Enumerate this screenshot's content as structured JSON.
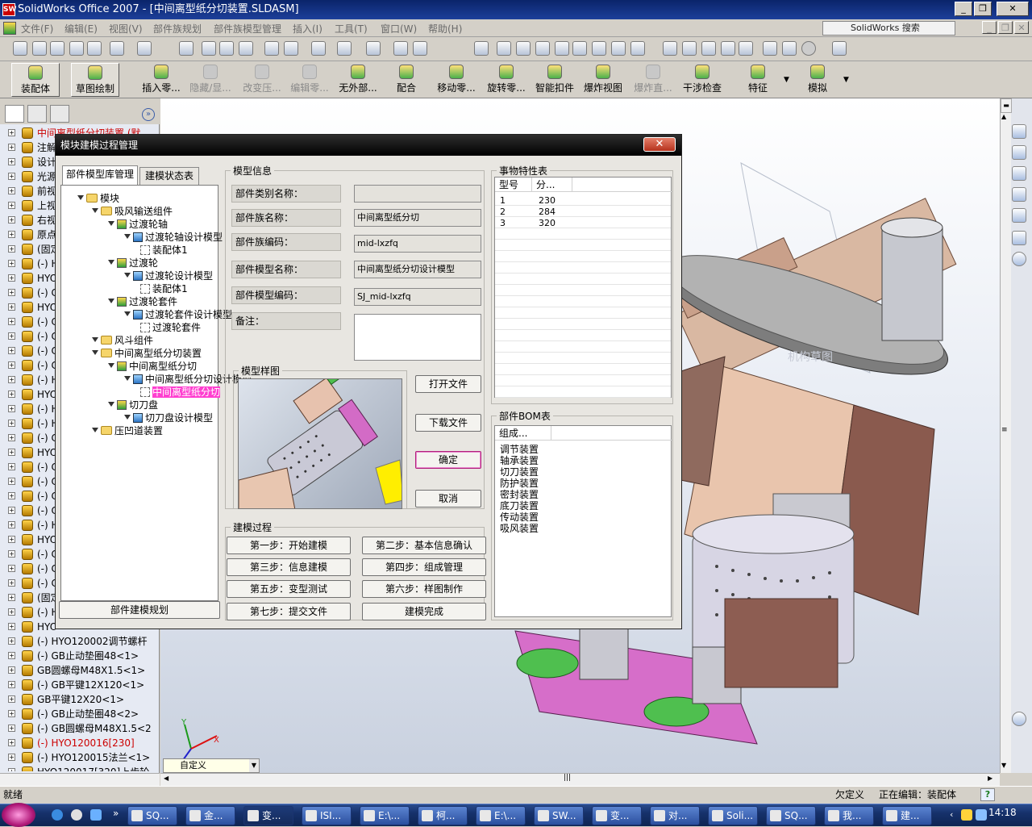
{
  "window": {
    "title": "SolidWorks Office 2007 - [中间离型纸分切装置.SLDASM]",
    "logo": "SW"
  },
  "menu": [
    "文件(F)",
    "编辑(E)",
    "视图(V)",
    "部件族规划",
    "部件族模型管理",
    "插入(I)",
    "工具(T)",
    "窗口(W)",
    "帮助(H)"
  ],
  "search_placeholder": "SolidWorks 搜索",
  "command_bar": [
    {
      "label": "装配体",
      "state": "pressed"
    },
    {
      "label": "草图绘制",
      "state": "pressed"
    },
    {
      "label": "插入零...",
      "state": "normal"
    },
    {
      "label": "隐藏/显...",
      "state": "disabled"
    },
    {
      "label": "改变压...",
      "state": "disabled"
    },
    {
      "label": "编辑零...",
      "state": "disabled"
    },
    {
      "label": "无外部...",
      "state": "normal"
    },
    {
      "label": "配合",
      "state": "normal"
    },
    {
      "label": "移动零...",
      "state": "normal"
    },
    {
      "label": "旋转零...",
      "state": "normal"
    },
    {
      "label": "智能扣件",
      "state": "normal"
    },
    {
      "label": "爆炸视图",
      "state": "normal"
    },
    {
      "label": "爆炸直...",
      "state": "disabled"
    },
    {
      "label": "干涉检查",
      "state": "normal"
    },
    {
      "label": "特征",
      "state": "normal"
    },
    {
      "label": "模拟",
      "state": "normal"
    }
  ],
  "feature_tree": [
    {
      "text": "中间离型纸分切装置  (默",
      "color": "#cc0000"
    },
    {
      "text": "注解"
    },
    {
      "text": "设计"
    },
    {
      "text": "光源"
    },
    {
      "text": "前视"
    },
    {
      "text": "上视"
    },
    {
      "text": "右视"
    },
    {
      "text": "原点"
    },
    {
      "text": "(固定"
    },
    {
      "text": "(-) H"
    },
    {
      "text": "HYO"
    },
    {
      "text": "(-) C"
    },
    {
      "text": "HYO"
    },
    {
      "text": "(-) C"
    },
    {
      "text": "(-) C"
    },
    {
      "text": "(-) C"
    },
    {
      "text": "(-) C"
    },
    {
      "text": "(-) H"
    },
    {
      "text": "HYO"
    },
    {
      "text": "(-) H"
    },
    {
      "text": "(-) H"
    },
    {
      "text": "(-) C"
    },
    {
      "text": "HYO"
    },
    {
      "text": "(-) C"
    },
    {
      "text": "(-) C"
    },
    {
      "text": "(-) C"
    },
    {
      "text": "(-) C"
    },
    {
      "text": "(-) H"
    },
    {
      "text": "HYO"
    },
    {
      "text": "(-) C"
    },
    {
      "text": "(-) C"
    },
    {
      "text": "(-) C"
    },
    {
      "text": "(固定"
    },
    {
      "text": "(-) H"
    },
    {
      "text": "HYO"
    },
    {
      "text": "(-) HYO120002调节螺杆"
    },
    {
      "text": "(-) GB止动垫圈48<1>"
    },
    {
      "text": "GB圆螺母M48X1.5<1>"
    },
    {
      "text": "(-) GB平键12X120<1>"
    },
    {
      "text": "GB平键12X20<1>"
    },
    {
      "text": "(-) GB止动垫圈48<2>"
    },
    {
      "text": "(-) GB圆螺母M48X1.5<2"
    },
    {
      "text": "(-) HYO120016[230]",
      "color": "#cc0000"
    },
    {
      "text": "(-) HYO120015法兰<1>"
    },
    {
      "text": "HYO120017[320]上齿轮"
    }
  ],
  "dialog": {
    "title": "模块建模过程管理",
    "close": "✕",
    "tabs": [
      "部件模型库管理",
      "建模状态表"
    ],
    "tree": [
      {
        "text": "模块",
        "level": 0,
        "icon": "folder"
      },
      {
        "text": "吸风输送组件",
        "level": 1,
        "icon": "folder"
      },
      {
        "text": "过渡轮轴",
        "level": 2,
        "icon": "assembly"
      },
      {
        "text": "过渡轮轴设计模型",
        "level": 3,
        "icon": "part"
      },
      {
        "text": "装配体1",
        "level": 4,
        "icon": "config"
      },
      {
        "text": "过渡轮",
        "level": 2,
        "icon": "assembly"
      },
      {
        "text": "过渡轮设计模型",
        "level": 3,
        "icon": "part"
      },
      {
        "text": "装配体1",
        "level": 4,
        "icon": "config"
      },
      {
        "text": "过渡轮套件",
        "level": 2,
        "icon": "assembly"
      },
      {
        "text": "过渡轮套件设计模型",
        "level": 3,
        "icon": "part"
      },
      {
        "text": "过渡轮套件",
        "level": 4,
        "icon": "config"
      },
      {
        "text": "风斗组件",
        "level": 1,
        "icon": "folder"
      },
      {
        "text": "中间离型纸分切装置",
        "level": 1,
        "icon": "folder"
      },
      {
        "text": "中间离型纸分切",
        "level": 2,
        "icon": "assembly"
      },
      {
        "text": "中间离型纸分切设计模型",
        "level": 3,
        "icon": "part"
      },
      {
        "text": "中间离型纸分切",
        "level": 4,
        "icon": "config",
        "selected": true
      },
      {
        "text": "切刀盘",
        "level": 2,
        "icon": "assembly"
      },
      {
        "text": "切刀盘设计模型",
        "level": 3,
        "icon": "part"
      },
      {
        "text": "压凹道装置",
        "level": 1,
        "icon": "folder"
      }
    ],
    "plan_button": "部件建模规划",
    "model_info": {
      "caption": "模型信息",
      "fields": [
        {
          "label": "部件类别名称：",
          "value": ""
        },
        {
          "label": "部件族名称：",
          "value": "中间离型纸分切"
        },
        {
          "label": "部件族编码：",
          "value": "mid-lxzfq"
        },
        {
          "label": "部件模型名称：",
          "value": "中间离型纸分切设计模型"
        },
        {
          "label": "部件模型编码：",
          "value": "SJ_mid-lxzfq"
        }
      ],
      "remark_label": "备注：",
      "remark_value": ""
    },
    "sample_caption": "模型样图",
    "buttons": {
      "open": "打开文件",
      "download": "下载文件",
      "ok": "确定",
      "cancel": "取消"
    },
    "process": {
      "caption": "建模过程",
      "steps": [
        "第一步：开始建模",
        "第二步：基本信息确认",
        "第三步：信息建模",
        "第四步：组成管理",
        "第五步：变型测试",
        "第六步：样图制作",
        "第七步：提交文件",
        "建模完成"
      ]
    },
    "event_table": {
      "caption": "事物特性表",
      "headers": [
        "型号",
        "分..."
      ],
      "rows": [
        [
          "1",
          "230"
        ],
        [
          "2",
          "284"
        ],
        [
          "3",
          "320"
        ]
      ]
    },
    "bom_table": {
      "caption": "部件BOM表",
      "header": "组成...",
      "rows": [
        "调节装置",
        "轴承装置",
        "切刀装置",
        "防护装置",
        "密封装置",
        "底刀装置",
        "传动装置",
        "吸风装置"
      ]
    }
  },
  "view_combo": "自定义",
  "watermark": "机构草图",
  "status": {
    "left": "就绪",
    "mid": "欠定义",
    "right": "正在编辑：装配体"
  },
  "taskbar": {
    "tasks": [
      "SQ...",
      "金...",
      "变...",
      "ISI...",
      "E:\\...",
      "柯...",
      "E:\\...",
      "SW...",
      "变...",
      "对...",
      "Soli...",
      "SQ...",
      "我...",
      "建..."
    ],
    "active_index": 2,
    "clock": "14:18"
  }
}
